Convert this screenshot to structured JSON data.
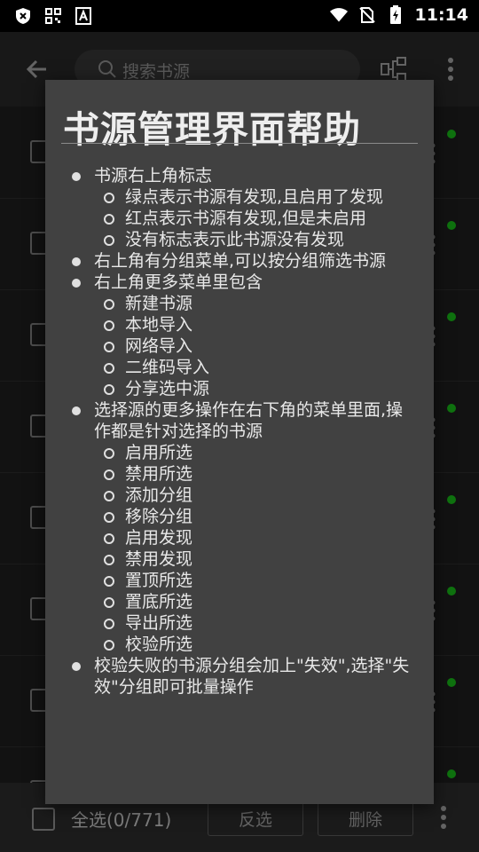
{
  "status_bar": {
    "time": "11:14",
    "left_icons": [
      "shield-x-icon",
      "qr-grid-icon",
      "font-a-icon"
    ],
    "right_icons": [
      "wifi-icon",
      "no-sim-icon",
      "battery-charging-icon"
    ]
  },
  "app_bar": {
    "search_placeholder": "搜索书源",
    "icons": [
      "back-arrow-icon",
      "search-icon",
      "group-filter-icon",
      "more-vert-icon"
    ]
  },
  "list_rows": [
    {
      "has_dot": true
    },
    {
      "has_dot": true
    },
    {
      "has_dot": true
    },
    {
      "has_dot": true
    },
    {
      "has_dot": true
    },
    {
      "has_dot": true
    },
    {
      "has_dot": true
    },
    {
      "has_dot": true
    }
  ],
  "bottom_bar": {
    "select_all_label": "全选(0/771)",
    "invert_label": "反选",
    "delete_label": "删除"
  },
  "dialog": {
    "title": "书源管理界面帮助",
    "sections": [
      {
        "text": "书源右上角标志",
        "items": [
          "绿点表示书源有发现,且启用了发现",
          "红点表示书源有发现,但是未启用",
          "没有标志表示此书源没有发现"
        ]
      },
      {
        "text": "右上角有分组菜单,可以按分组筛选书源",
        "items": []
      },
      {
        "text": "右上角更多菜单里包含",
        "items": [
          "新建书源",
          "本地导入",
          "网络导入",
          "二维码导入",
          "分享选中源"
        ]
      },
      {
        "text": "选择源的更多操作在右下角的菜单里面,操作都是针对选择的书源",
        "items": [
          "启用所选",
          "禁用所选",
          "添加分组",
          "移除分组",
          "启用发现",
          "禁用发现",
          "置顶所选",
          "置底所选",
          "导出所选",
          "校验所选"
        ]
      },
      {
        "text": "校验失败的书源分组会加上\"失效\",选择\"失效\"分组即可批量操作",
        "items": []
      }
    ]
  },
  "colors": {
    "dialog_bg": "#414141",
    "dot_green": "#18b018",
    "background": "#1c1c1c"
  }
}
